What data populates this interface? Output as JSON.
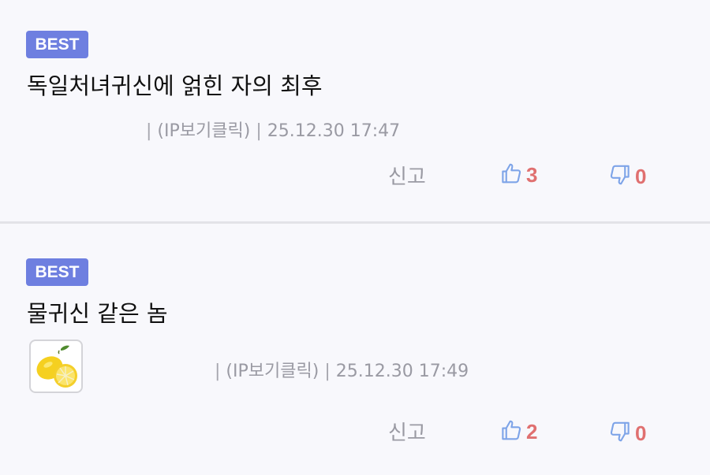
{
  "comments": [
    {
      "badge": "BEST",
      "title": "독일처녀귀신에 얽힌 자의 최후",
      "meta_sep1": "|",
      "ip_label": "(IP보기클릭)",
      "meta_sep2": "|",
      "date": "25.12.30 17:47",
      "report_label": "신고",
      "likes": "3",
      "dislikes": "0",
      "has_avatar": false
    },
    {
      "badge": "BEST",
      "title": "물귀신 같은 놈",
      "meta_sep1": "|",
      "ip_label": "(IP보기클릭)",
      "meta_sep2": "|",
      "date": "25.12.30 17:49",
      "report_label": "신고",
      "likes": "2",
      "dislikes": "0",
      "has_avatar": true,
      "avatar_icon": "lemon-icon"
    }
  ],
  "colors": {
    "badge_bg": "#6e7fe0",
    "count": "#e07070",
    "thumb": "#7ea4e8",
    "background": "#f8f8fc"
  }
}
